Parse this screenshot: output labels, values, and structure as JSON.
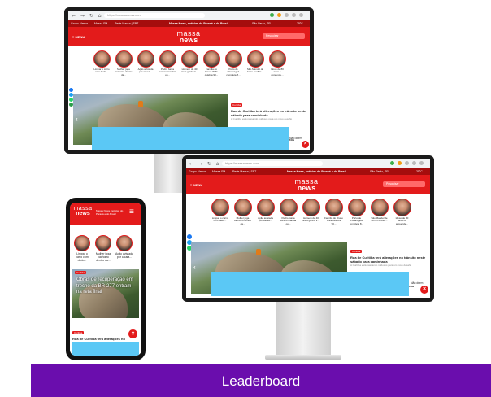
{
  "browser": {
    "url": "https://massanews.com",
    "nav_glyphs": "← → ↻ ⌂"
  },
  "site": {
    "logo_line1": "massa",
    "logo_line2": "news",
    "menu_label": "≡ MENU",
    "search_placeholder": "Pesquisar",
    "topbar": {
      "item1": "Grupo Massa",
      "item2": "Massa FM",
      "item3": "Rede Massa | SBT",
      "headline": "Massa News, notícias do Paraná e do Brasil",
      "city": "São Paulo, SP",
      "weather": "25°C"
    }
  },
  "stories": [
    {
      "caption": "Limpar o carro com dedo..."
    },
    {
      "caption": "Mulher joga cachorro dentro da..."
    },
    {
      "caption": "Ação avistada por causa..."
    },
    {
      "caption": "Pedro baixa sorteio mandar ou..."
    },
    {
      "caption": "Homem de 40 anos ganha li..."
    },
    {
      "caption": "Família do Bruno Willk celebra 90..."
    },
    {
      "caption": "Porto de Paranaguá completa 8..."
    },
    {
      "caption": "São Mandel de borro conflito..."
    },
    {
      "caption": "Idoso de 80 anos é apreende..."
    }
  ],
  "news": {
    "badge": "Curitiba",
    "story1_title": "Rua de Curitiba terá alterações no trânsito neste sábado para caminhada",
    "story1_sub": "A Curitiba está passando ruidosos para um novo desafio",
    "story2_title": "Curitiba convoca crianças de 5 a 11 anos",
    "story2_tail": "Não durm"
  },
  "phone": {
    "topbar_text": "Massa News, notícias do Paraná e do Brasil",
    "hero_text": "Obras de recuperação em trecho da BR-277 entram na reta final",
    "news_title": "Rua de Curitiba terá alterações no trânsito neste sábado para caminhada",
    "news_sub": "A Curitiba está passando ruidosos"
  },
  "footer": {
    "label": "Leaderboard"
  },
  "colors": {
    "brand_red": "#e31b1b",
    "leaderboard_ad": "#5bc8f5",
    "banner": "#6a0dad"
  },
  "icons": [
    "facebook-icon",
    "twitter-icon",
    "whatsapp-icon",
    "close-icon",
    "hamburger-icon",
    "search-icon"
  ]
}
